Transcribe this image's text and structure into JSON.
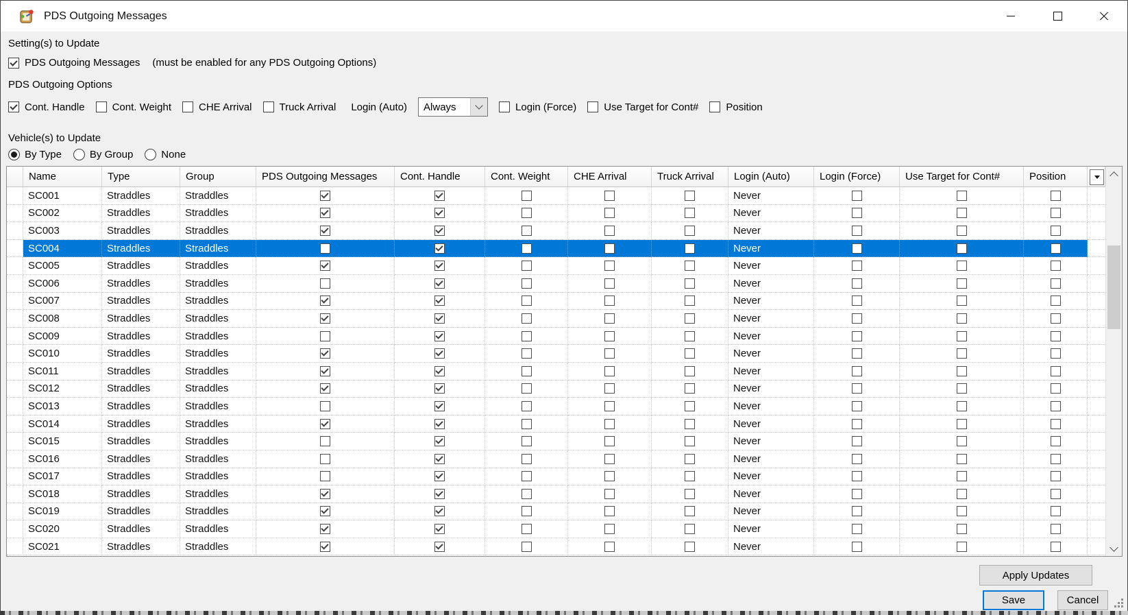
{
  "window": {
    "title": "PDS Outgoing Messages"
  },
  "colors": {
    "accent": "#0078d7",
    "selected_row_bg": "#0078d7",
    "titlebar_bg": "#ffffff",
    "dialog_bg": "#f0f0f0",
    "grid_bg": "#ffffff"
  },
  "settings_section": {
    "label": "Setting(s) to Update",
    "pds_checkbox_label": "PDS Outgoing Messages",
    "pds_note": "(must be enabled for any PDS Outgoing Options)",
    "pds_checked": true
  },
  "options_section": {
    "label": "PDS Outgoing Options",
    "checkboxes_left": [
      {
        "label": "Cont. Handle",
        "checked": true
      },
      {
        "label": "Cont. Weight",
        "checked": false
      },
      {
        "label": "CHE Arrival",
        "checked": false
      },
      {
        "label": "Truck Arrival",
        "checked": false
      }
    ],
    "login_auto_label": "Login (Auto)",
    "login_auto_value": "Always",
    "checkboxes_right": [
      {
        "label": "Login (Force)",
        "checked": false
      },
      {
        "label": "Use Target for Cont#",
        "checked": false
      },
      {
        "label": "Position",
        "checked": false
      }
    ]
  },
  "vehicles_section": {
    "label": "Vehicle(s) to Update",
    "radios": [
      {
        "label": "By Type",
        "selected": true
      },
      {
        "label": "By Group",
        "selected": false
      },
      {
        "label": "None",
        "selected": false
      }
    ]
  },
  "grid": {
    "columns": [
      "Name",
      "Type",
      "Group",
      "PDS Outgoing Messages",
      "Cont. Handle",
      "Cont. Weight",
      "CHE Arrival",
      "Truck Arrival",
      "Login (Auto)",
      "Login (Force)",
      "Use Target for Cont#",
      "Position"
    ],
    "selected_row": "SC004",
    "rows": [
      {
        "name": "SC001",
        "type": "Straddles",
        "group": "Straddles",
        "pds": true,
        "contHandle": true,
        "contWeight": false,
        "cheArrival": false,
        "truckArrival": false,
        "loginAuto": "Never",
        "loginForce": false,
        "useTarget": false,
        "position": false
      },
      {
        "name": "SC002",
        "type": "Straddles",
        "group": "Straddles",
        "pds": true,
        "contHandle": true,
        "contWeight": false,
        "cheArrival": false,
        "truckArrival": false,
        "loginAuto": "Never",
        "loginForce": false,
        "useTarget": false,
        "position": false
      },
      {
        "name": "SC003",
        "type": "Straddles",
        "group": "Straddles",
        "pds": true,
        "contHandle": true,
        "contWeight": false,
        "cheArrival": false,
        "truckArrival": false,
        "loginAuto": "Never",
        "loginForce": false,
        "useTarget": false,
        "position": false
      },
      {
        "name": "SC004",
        "type": "Straddles",
        "group": "Straddles",
        "pds": false,
        "contHandle": true,
        "contWeight": false,
        "cheArrival": false,
        "truckArrival": false,
        "loginAuto": "Never",
        "loginForce": false,
        "useTarget": false,
        "position": false
      },
      {
        "name": "SC005",
        "type": "Straddles",
        "group": "Straddles",
        "pds": true,
        "contHandle": true,
        "contWeight": false,
        "cheArrival": false,
        "truckArrival": false,
        "loginAuto": "Never",
        "loginForce": false,
        "useTarget": false,
        "position": false
      },
      {
        "name": "SC006",
        "type": "Straddles",
        "group": "Straddles",
        "pds": false,
        "contHandle": true,
        "contWeight": false,
        "cheArrival": false,
        "truckArrival": false,
        "loginAuto": "Never",
        "loginForce": false,
        "useTarget": false,
        "position": false
      },
      {
        "name": "SC007",
        "type": "Straddles",
        "group": "Straddles",
        "pds": true,
        "contHandle": true,
        "contWeight": false,
        "cheArrival": false,
        "truckArrival": false,
        "loginAuto": "Never",
        "loginForce": false,
        "useTarget": false,
        "position": false
      },
      {
        "name": "SC008",
        "type": "Straddles",
        "group": "Straddles",
        "pds": true,
        "contHandle": true,
        "contWeight": false,
        "cheArrival": false,
        "truckArrival": false,
        "loginAuto": "Never",
        "loginForce": false,
        "useTarget": false,
        "position": false
      },
      {
        "name": "SC009",
        "type": "Straddles",
        "group": "Straddles",
        "pds": false,
        "contHandle": true,
        "contWeight": false,
        "cheArrival": false,
        "truckArrival": false,
        "loginAuto": "Never",
        "loginForce": false,
        "useTarget": false,
        "position": false
      },
      {
        "name": "SC010",
        "type": "Straddles",
        "group": "Straddles",
        "pds": true,
        "contHandle": true,
        "contWeight": false,
        "cheArrival": false,
        "truckArrival": false,
        "loginAuto": "Never",
        "loginForce": false,
        "useTarget": false,
        "position": false
      },
      {
        "name": "SC011",
        "type": "Straddles",
        "group": "Straddles",
        "pds": true,
        "contHandle": true,
        "contWeight": false,
        "cheArrival": false,
        "truckArrival": false,
        "loginAuto": "Never",
        "loginForce": false,
        "useTarget": false,
        "position": false
      },
      {
        "name": "SC012",
        "type": "Straddles",
        "group": "Straddles",
        "pds": true,
        "contHandle": true,
        "contWeight": false,
        "cheArrival": false,
        "truckArrival": false,
        "loginAuto": "Never",
        "loginForce": false,
        "useTarget": false,
        "position": false
      },
      {
        "name": "SC013",
        "type": "Straddles",
        "group": "Straddles",
        "pds": false,
        "contHandle": true,
        "contWeight": false,
        "cheArrival": false,
        "truckArrival": false,
        "loginAuto": "Never",
        "loginForce": false,
        "useTarget": false,
        "position": false
      },
      {
        "name": "SC014",
        "type": "Straddles",
        "group": "Straddles",
        "pds": true,
        "contHandle": true,
        "contWeight": false,
        "cheArrival": false,
        "truckArrival": false,
        "loginAuto": "Never",
        "loginForce": false,
        "useTarget": false,
        "position": false
      },
      {
        "name": "SC015",
        "type": "Straddles",
        "group": "Straddles",
        "pds": false,
        "contHandle": true,
        "contWeight": false,
        "cheArrival": false,
        "truckArrival": false,
        "loginAuto": "Never",
        "loginForce": false,
        "useTarget": false,
        "position": false
      },
      {
        "name": "SC016",
        "type": "Straddles",
        "group": "Straddles",
        "pds": false,
        "contHandle": true,
        "contWeight": false,
        "cheArrival": false,
        "truckArrival": false,
        "loginAuto": "Never",
        "loginForce": false,
        "useTarget": false,
        "position": false
      },
      {
        "name": "SC017",
        "type": "Straddles",
        "group": "Straddles",
        "pds": false,
        "contHandle": true,
        "contWeight": false,
        "cheArrival": false,
        "truckArrival": false,
        "loginAuto": "Never",
        "loginForce": false,
        "useTarget": false,
        "position": false
      },
      {
        "name": "SC018",
        "type": "Straddles",
        "group": "Straddles",
        "pds": true,
        "contHandle": true,
        "contWeight": false,
        "cheArrival": false,
        "truckArrival": false,
        "loginAuto": "Never",
        "loginForce": false,
        "useTarget": false,
        "position": false
      },
      {
        "name": "SC019",
        "type": "Straddles",
        "group": "Straddles",
        "pds": true,
        "contHandle": true,
        "contWeight": false,
        "cheArrival": false,
        "truckArrival": false,
        "loginAuto": "Never",
        "loginForce": false,
        "useTarget": false,
        "position": false
      },
      {
        "name": "SC020",
        "type": "Straddles",
        "group": "Straddles",
        "pds": true,
        "contHandle": true,
        "contWeight": false,
        "cheArrival": false,
        "truckArrival": false,
        "loginAuto": "Never",
        "loginForce": false,
        "useTarget": false,
        "position": false
      },
      {
        "name": "SC021",
        "type": "Straddles",
        "group": "Straddles",
        "pds": true,
        "contHandle": true,
        "contWeight": false,
        "cheArrival": false,
        "truckArrival": false,
        "loginAuto": "Never",
        "loginForce": false,
        "useTarget": false,
        "position": false
      }
    ]
  },
  "buttons": {
    "apply": "Apply Updates",
    "save": "Save",
    "cancel": "Cancel"
  }
}
